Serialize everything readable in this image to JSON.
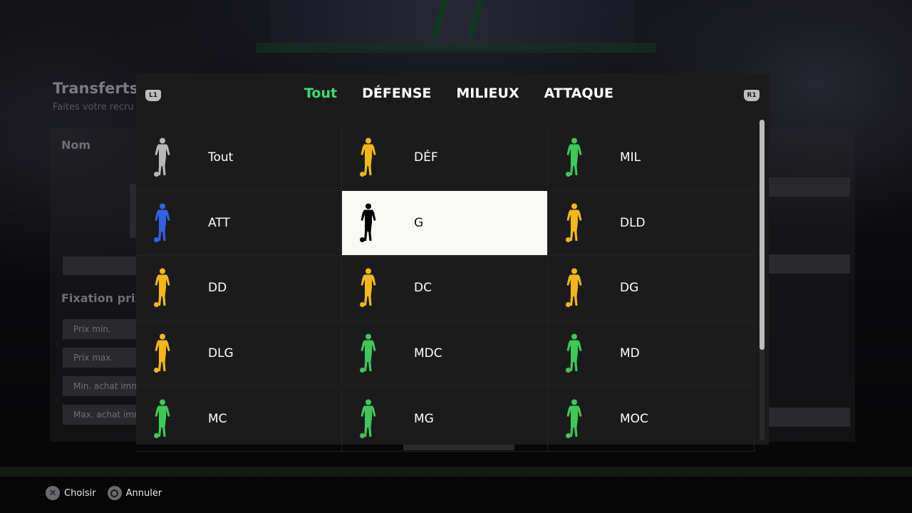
{
  "background": {
    "title": "Transferts",
    "subtitle": "Faites votre recru",
    "nom_label": "Nom",
    "fixation_label": "Fixation prix",
    "fields": [
      "Prix min.",
      "Prix max.",
      "Min. achat imm",
      "Max. achat imm"
    ]
  },
  "modal": {
    "left_bumper": "L1",
    "right_bumper": "R1",
    "tabs": [
      {
        "label": "Tout",
        "active": true
      },
      {
        "label": "DÉFENSE",
        "active": false
      },
      {
        "label": "MILIEUX",
        "active": false
      },
      {
        "label": "ATTAQUE",
        "active": false
      }
    ],
    "positions": [
      {
        "label": "Tout",
        "color": "#b8b8b8",
        "selected": false
      },
      {
        "label": "DÉF",
        "color": "#f2b818",
        "selected": false
      },
      {
        "label": "MIL",
        "color": "#3fc758",
        "selected": false
      },
      {
        "label": "ATT",
        "color": "#3460e8",
        "selected": false
      },
      {
        "label": "G",
        "color": "#000000",
        "selected": true
      },
      {
        "label": "DLD",
        "color": "#f2b818",
        "selected": false
      },
      {
        "label": "DD",
        "color": "#f2b818",
        "selected": false
      },
      {
        "label": "DC",
        "color": "#f2b818",
        "selected": false
      },
      {
        "label": "DG",
        "color": "#f2b818",
        "selected": false
      },
      {
        "label": "DLG",
        "color": "#f2b818",
        "selected": false
      },
      {
        "label": "MDC",
        "color": "#3fc758",
        "selected": false
      },
      {
        "label": "MD",
        "color": "#3fc758",
        "selected": false
      },
      {
        "label": "MC",
        "color": "#3fc758",
        "selected": false
      },
      {
        "label": "MG",
        "color": "#3fc758",
        "selected": false
      },
      {
        "label": "MOC",
        "color": "#3fc758",
        "selected": false
      }
    ]
  },
  "footer": {
    "choose_label": "Choisir",
    "choose_icon": "cross-button-icon",
    "cancel_label": "Annuler",
    "cancel_icon": "circle-button-icon"
  },
  "colors": {
    "accent": "#3ddc6e",
    "selected_bg": "#f8f8f4",
    "modal_bg": "#1b1b1c"
  }
}
